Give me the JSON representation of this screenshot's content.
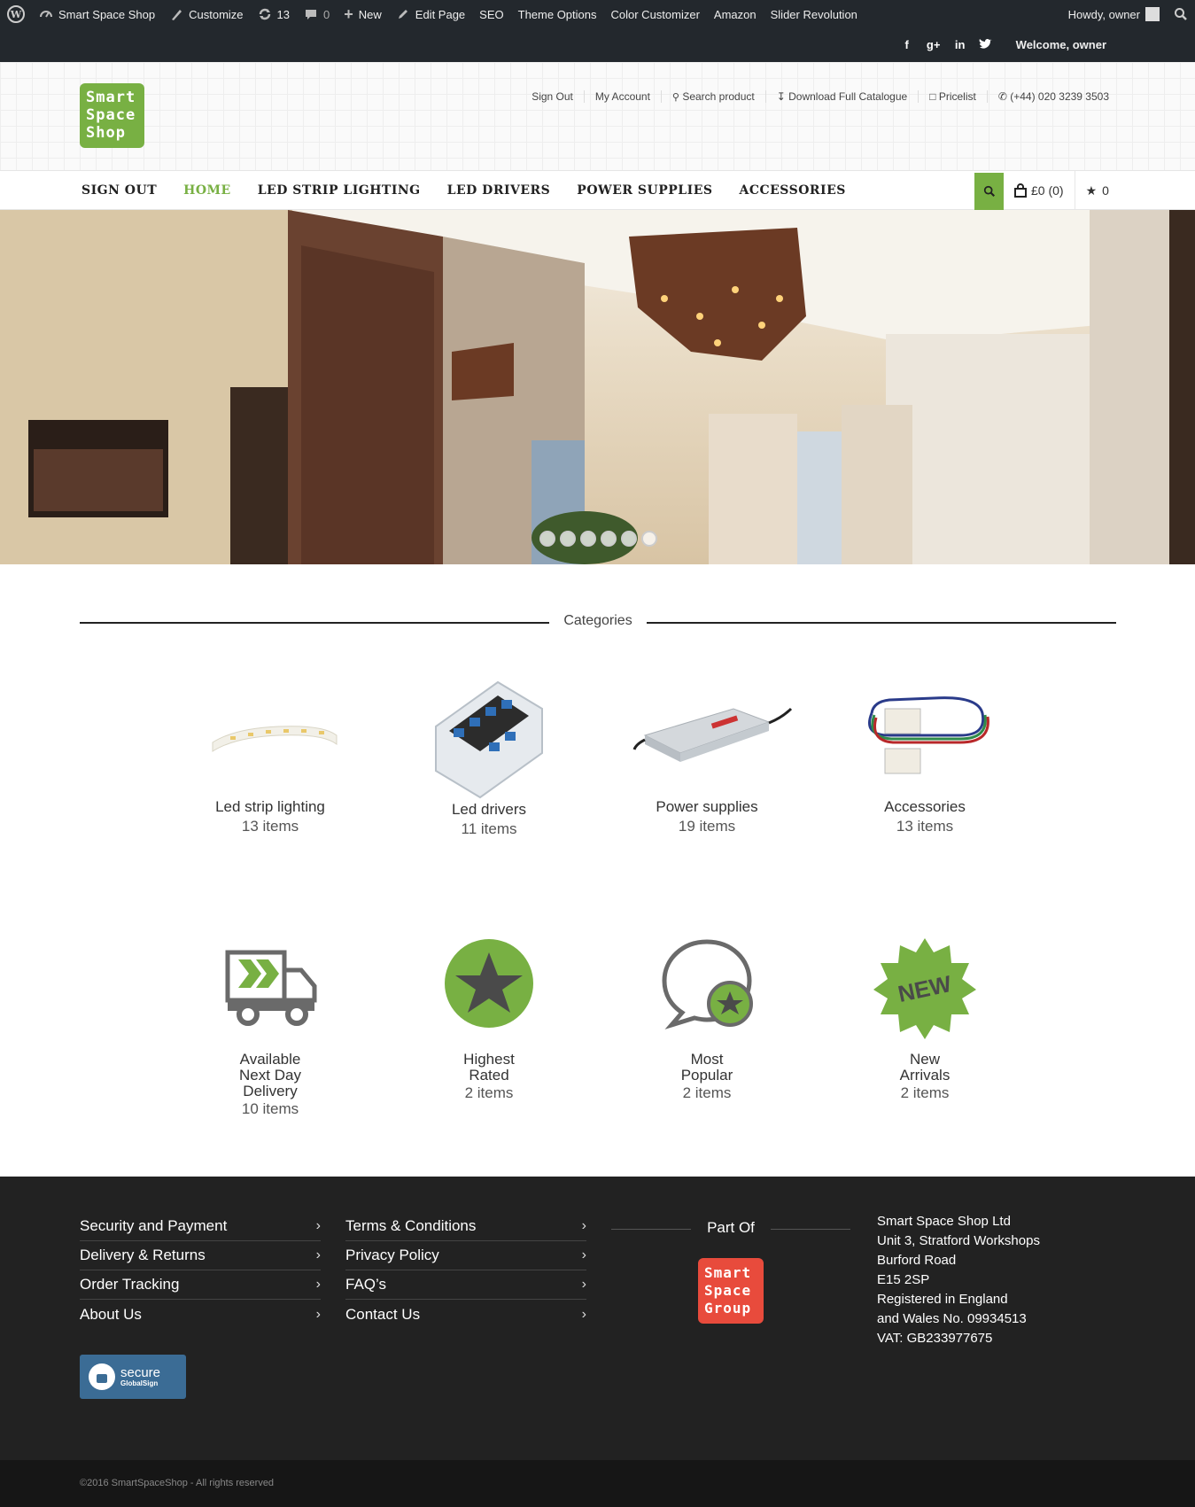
{
  "adminbar": {
    "site_name": "Smart Space Shop",
    "customize": "Customize",
    "updates": "13",
    "comments": "0",
    "new": "New",
    "edit_page": "Edit Page",
    "seo": "SEO",
    "theme_options": "Theme Options",
    "color_customizer": "Color Customizer",
    "amazon": "Amazon",
    "slider_revolution": "Slider Revolution",
    "howdy": "Howdy, owner",
    "welcome": "Welcome, owner"
  },
  "header": {
    "logo_lines": [
      "Smart",
      "Space",
      "Shop"
    ],
    "links": [
      "Sign Out",
      "My Account",
      "Search product",
      "Download Full Catalogue",
      "Pricelist",
      "(+44) 020 3239 3503"
    ]
  },
  "nav": {
    "items": [
      "SIGN OUT",
      "HOME",
      "LED STRIP LIGHTING",
      "LED DRIVERS",
      "POWER SUPPLIES",
      "ACCESSORIES"
    ],
    "cart": "£0 (0)",
    "wishlist": "0"
  },
  "categories": {
    "title": "Categories",
    "items": [
      {
        "name": "Led strip lighting",
        "count": "13 items"
      },
      {
        "name": "Led drivers",
        "count": "11 items"
      },
      {
        "name": "Power supplies",
        "count": "19 items"
      },
      {
        "name": "Accessories",
        "count": "13 items"
      }
    ],
    "features": [
      {
        "name_lines": [
          "Available",
          "Next Day",
          "Delivery"
        ],
        "count": "10 items"
      },
      {
        "name_lines": [
          "Highest",
          "Rated"
        ],
        "count": "2 items"
      },
      {
        "name_lines": [
          "Most",
          "Popular"
        ],
        "count": "2 items"
      },
      {
        "name_lines": [
          "New",
          "Arrivals"
        ],
        "count": "2 items"
      }
    ]
  },
  "footer": {
    "col1": [
      "Security and Payment",
      "Delivery & Returns",
      "Order Tracking",
      "About Us"
    ],
    "col2": [
      "Terms & Conditions",
      "Privacy Policy",
      "FAQ’s",
      "Contact Us"
    ],
    "part_of": "Part Of",
    "group_logo_lines": [
      "Smart",
      "Space",
      "Group"
    ],
    "address": [
      "Smart Space Shop Ltd",
      "Unit 3, Stratford Workshops",
      "Burford Road",
      "E15 2SP",
      "Registered in England",
      "and Wales No. 09934513",
      "VAT: GB233977675"
    ],
    "secure_badge": {
      "line1": "secure",
      "line2": "GlobalSign"
    },
    "copyright": "©2016 SmartSpaceShop - All rights reserved"
  },
  "colors": {
    "accent": "#78b043",
    "admin_bar": "#23282d",
    "footer": "#222222",
    "group_logo": "#e84b3c"
  }
}
